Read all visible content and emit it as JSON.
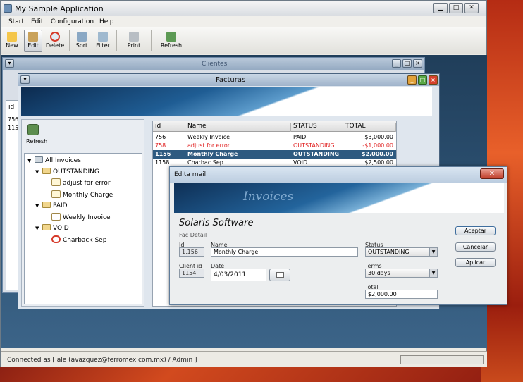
{
  "app": {
    "title": "My Sample Application"
  },
  "menu": [
    "Start",
    "Edit",
    "Configuration",
    "Help"
  ],
  "toolbar": {
    "new": "New",
    "edit": "Edit",
    "delete": "Delete",
    "sort": "Sort",
    "filter": "Filter",
    "print": "Print",
    "refresh": "Refresh"
  },
  "clientes": {
    "title": "Clientes",
    "rows": [
      "id",
      "756",
      "115"
    ]
  },
  "facturas": {
    "title": "Facturas",
    "refresh": "Refresh",
    "tree": {
      "root": "All Invoices",
      "groups": [
        {
          "label": "OUTSTANDING",
          "items": [
            "adjust for error",
            "Monthly Charge"
          ]
        },
        {
          "label": "PAID",
          "items": [
            "Weekly Invoice"
          ]
        },
        {
          "label": "VOID",
          "items": [
            "Charback Sep"
          ]
        }
      ]
    },
    "columns": [
      "id",
      "Name",
      "STATUS",
      "TOTAL"
    ],
    "rows": [
      {
        "id": "756",
        "name": "Weekly Invoice",
        "status": "PAID",
        "total": "$3,000.00"
      },
      {
        "id": "758",
        "name": "adjust for error",
        "status": "OUTSTANDING",
        "total": "-$1,000.00"
      },
      {
        "id": "1156",
        "name": "Monthly Charge",
        "status": "OUTSTANDING",
        "total": "$2,000.00"
      },
      {
        "id": "1158",
        "name": "Charbac Sep",
        "status": "VOID",
        "total": "$2,500.00"
      }
    ]
  },
  "edita": {
    "title": "Edita mail",
    "banner": "Invoices",
    "company": "Solaris Software",
    "section": "Fac Detail",
    "id_label": "Id",
    "id_value": "1,156",
    "name_label": "Name",
    "name_value": "Monthly Charge",
    "status_label": "Status",
    "status_value": "OUTSTANDING",
    "client_label": "Client id",
    "client_value": "1154",
    "date_label": "Date",
    "date_value": "4/03/2011",
    "terms_label": "Terms",
    "terms_value": "30 days",
    "total_label": "Total",
    "total_value": "$2,000.00",
    "aceptar": "Aceptar",
    "cancelar": "Cancelar",
    "aplicar": "Aplicar"
  },
  "status": {
    "text": "Connected as [ ale (avazquez@ferromex.com.mx) / Admin ]"
  },
  "window_buttons": {
    "minimize": "▁",
    "maximize": "□",
    "close": "✕"
  }
}
